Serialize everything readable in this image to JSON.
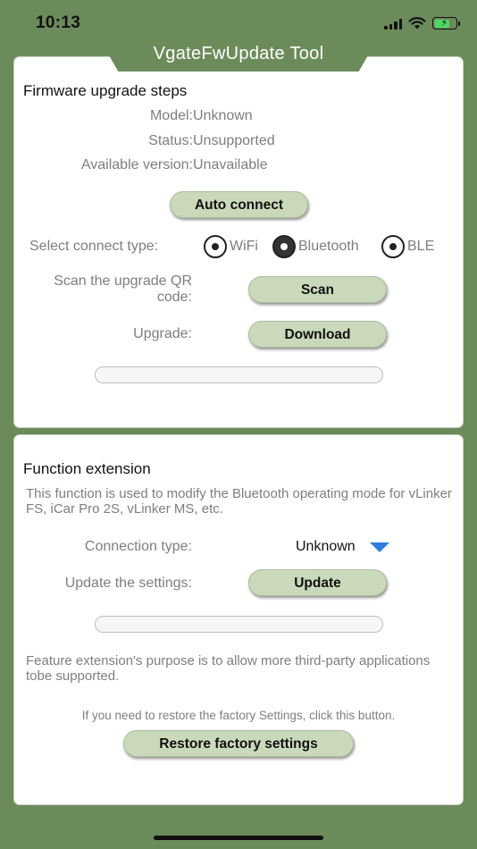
{
  "status_bar": {
    "time": "10:13",
    "battery_color": "#4cd964"
  },
  "app": {
    "title": "VgateFwUpdate Tool",
    "background": "#6c8b5a",
    "button_color": "#cbd9bb"
  },
  "firmware": {
    "section_title": "Firmware upgrade steps",
    "model_label": "Model:",
    "model_value": "Unknown",
    "status_label": "Status:",
    "status_value": "Unsupported",
    "version_label": "Available version:",
    "version_value": "Unavailable",
    "auto_connect_label": "Auto connect",
    "connect_type_label": "Select connect type:",
    "connect_options": [
      {
        "label": "WiFi",
        "selected": false
      },
      {
        "label": "Bluetooth",
        "selected": true
      },
      {
        "label": "BLE",
        "selected": false
      }
    ],
    "scan_label_line1": "Scan the upgrade QR",
    "scan_label_line2": "code:",
    "scan_button": "Scan",
    "upgrade_label": "Upgrade:",
    "download_button": "Download",
    "progress": 0
  },
  "extension": {
    "section_title": "Function extension",
    "description": "This function is used to modify the Bluetooth operating mode for vLinker FS, iCar Pro 2S, vLinker MS, etc.",
    "connection_type_label": "Connection type:",
    "connection_type_value": "Unknown",
    "update_label": "Update the settings:",
    "update_button": "Update",
    "progress": 0,
    "purpose_text": "Feature extension's purpose is to allow more third-party applications tobe supported.",
    "restore_hint": "If you need to restore the factory Settings, click this button.",
    "restore_button": "Restore factory settings",
    "dropdown_color": "#2e7de0"
  }
}
